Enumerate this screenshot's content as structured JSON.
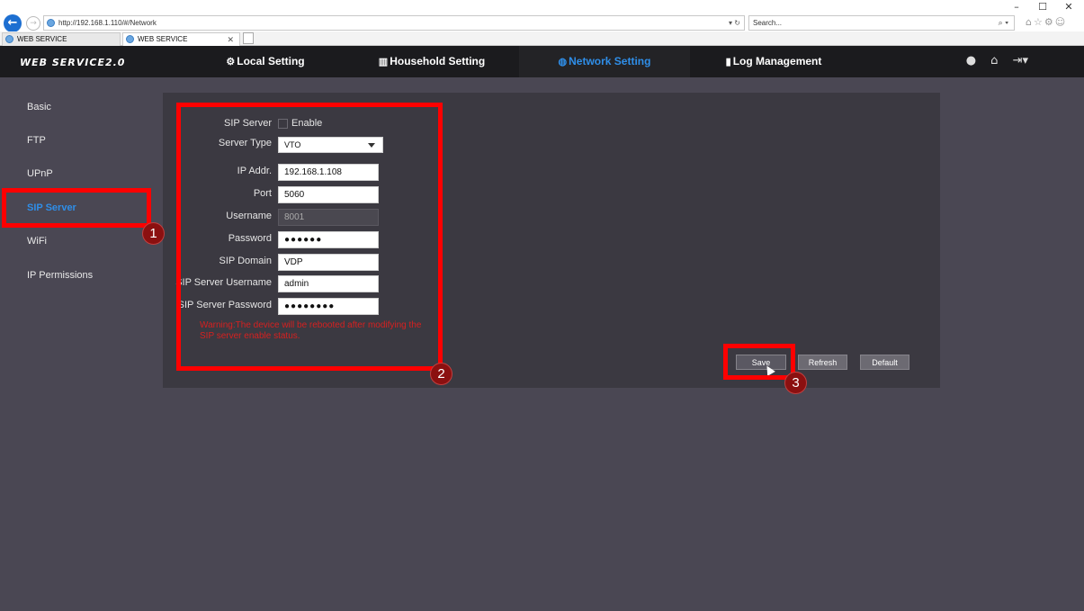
{
  "browser": {
    "url": "http://192.168.1.110/#/Network",
    "search_placeholder": "Search...",
    "tabs": [
      {
        "label": "WEB SERVICE"
      },
      {
        "label": "WEB SERVICE"
      }
    ]
  },
  "app": {
    "logo": "WEB SERVICE2.0",
    "menu": [
      {
        "label": "Local Setting",
        "icon": "gear-icon"
      },
      {
        "label": "Household Setting",
        "icon": "building-icon"
      },
      {
        "label": "Network Setting",
        "icon": "globe-icon"
      },
      {
        "label": "Log Management",
        "icon": "log-icon"
      }
    ]
  },
  "sidebar": {
    "items": [
      {
        "label": "Basic"
      },
      {
        "label": "FTP"
      },
      {
        "label": "UPnP"
      },
      {
        "label": "SIP Server"
      },
      {
        "label": "WiFi"
      },
      {
        "label": "IP Permissions"
      }
    ]
  },
  "form": {
    "sip_server_label": "SIP Server",
    "enable_label": "Enable",
    "server_type_label": "Server Type",
    "server_type_value": "VTO",
    "ip_label": "IP Addr.",
    "ip_value": "192.168.1.108",
    "port_label": "Port",
    "port_value": "5060",
    "username_label": "Username",
    "username_value": "8001",
    "password_label": "Password",
    "password_value": "●●●●●●",
    "domain_label": "SIP Domain",
    "domain_value": "VDP",
    "sip_user_label": "SIP Server Username",
    "sip_user_value": "admin",
    "sip_pass_label": "SIP Server Password",
    "sip_pass_value": "●●●●●●●●",
    "warning": "Warning:The device will be rebooted after modifying the SIP server enable status."
  },
  "buttons": {
    "save": "Save",
    "refresh": "Refresh",
    "default": "Default"
  },
  "annotations": {
    "badge1": "1",
    "badge2": "2",
    "badge3": "3",
    "color": "#ff0000"
  }
}
